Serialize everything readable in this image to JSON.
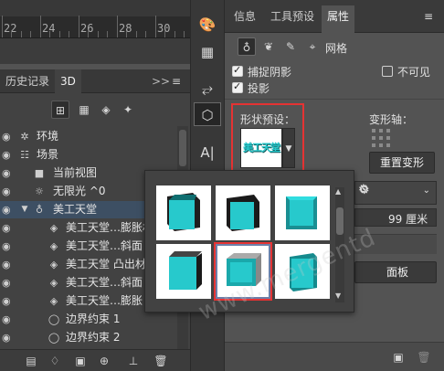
{
  "ruler": {
    "numbers": [
      "22",
      "24",
      "26",
      "28",
      "30"
    ]
  },
  "left_panel": {
    "tabs": [
      "历史记录",
      "3D"
    ],
    "collapse_glyph": ">>",
    "menu_glyph": "≡",
    "toolbar_icons": [
      "scene-filter-icon",
      "mesh-filter-icon",
      "material-filter-icon",
      "light-filter-icon"
    ],
    "rows": [
      {
        "label": "环境",
        "icon": "environment-icon",
        "indent": 0
      },
      {
        "label": "场景",
        "icon": "scene-icon",
        "indent": 0
      },
      {
        "label": "当前视图",
        "icon": "camera-icon",
        "indent": 1
      },
      {
        "label": "无限光 ^0",
        "icon": "infinite-light-icon",
        "indent": 1
      },
      {
        "label": "美工天堂",
        "icon": "mesh-icon",
        "indent": 1,
        "selected": true
      },
      {
        "label": "美工天堂…膨胀材质",
        "icon": "material-icon",
        "indent": 2
      },
      {
        "label": "美工天堂…斜面",
        "icon": "material-icon",
        "indent": 2
      },
      {
        "label": "美工天堂 凸出材质",
        "icon": "material-icon",
        "indent": 2
      },
      {
        "label": "美工天堂…斜面",
        "icon": "material-icon",
        "indent": 2
      },
      {
        "label": "美工天堂…膨胀",
        "icon": "material-icon",
        "indent": 2
      },
      {
        "label": "边界约束 1",
        "icon": "constraint-icon",
        "indent": 2
      },
      {
        "label": "边界约束 2",
        "icon": "constraint-icon",
        "indent": 2
      }
    ]
  },
  "tool_strip": [
    "palette-icon",
    "grid-icon",
    "brush-settings-icon",
    "3d-cube-icon",
    "character-icon"
  ],
  "right_panel": {
    "tabs": [
      "信息",
      "工具预设",
      "属性"
    ],
    "menu_glyph": "≡",
    "sub_tabs_label": "网格",
    "checkboxes": [
      {
        "label": "捕捉阴影",
        "checked": true
      },
      {
        "label": "投影",
        "checked": true
      },
      {
        "label": "不可见",
        "checked": false
      }
    ],
    "shape_preset_label": "形状预设：",
    "preset_preview_text": "美工天堂",
    "deform_axis_label": "变形轴：",
    "reset_deform_button": "重置变形",
    "depth_value": "99 厘米",
    "panel_button": "面板"
  },
  "popup": {
    "gear_glyph": "⚙",
    "selected_index": 4
  },
  "watermark": "www.mergentd",
  "colors": {
    "cube": "#27c9cc",
    "selection": "#3d4f63",
    "highlight": "#e53333",
    "thumb_sel": "#6d7fa8"
  }
}
